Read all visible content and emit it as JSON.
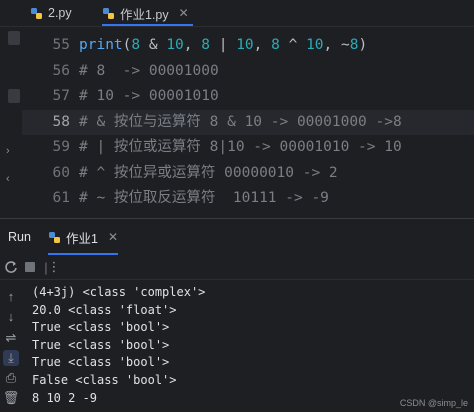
{
  "tabs": [
    {
      "label": "2.py",
      "active": false
    },
    {
      "label": "作业1.py",
      "active": true
    }
  ],
  "editor": {
    "lines": [
      {
        "num": "55",
        "current": false,
        "tokens": [
          {
            "t": "print",
            "c": "fn"
          },
          {
            "t": "(",
            "c": "txt"
          },
          {
            "t": "8",
            "c": "num"
          },
          {
            "t": " & ",
            "c": "txt"
          },
          {
            "t": "10",
            "c": "num"
          },
          {
            "t": ", ",
            "c": "txt"
          },
          {
            "t": "8",
            "c": "num"
          },
          {
            "t": " | ",
            "c": "txt"
          },
          {
            "t": "10",
            "c": "num"
          },
          {
            "t": ", ",
            "c": "txt"
          },
          {
            "t": "8",
            "c": "num"
          },
          {
            "t": " ^ ",
            "c": "txt"
          },
          {
            "t": "10",
            "c": "num"
          },
          {
            "t": ", ~",
            "c": "txt"
          },
          {
            "t": "8",
            "c": "num"
          },
          {
            "t": ")",
            "c": "txt"
          }
        ]
      },
      {
        "num": "56",
        "current": false,
        "tokens": [
          {
            "t": "# 8  -> 00001000",
            "c": "cmt"
          }
        ]
      },
      {
        "num": "57",
        "current": false,
        "tokens": [
          {
            "t": "# 10 -> 00001010",
            "c": "cmt"
          }
        ]
      },
      {
        "num": "58",
        "current": true,
        "tokens": [
          {
            "t": "# & 按位与运算符 8 & 10 -> 00001000 ->8",
            "c": "cmt"
          }
        ]
      },
      {
        "num": "59",
        "current": false,
        "tokens": [
          {
            "t": "# | 按位或运算符 8|10 -> 00001010 -> 10",
            "c": "cmt"
          }
        ]
      },
      {
        "num": "60",
        "current": false,
        "tokens": [
          {
            "t": "# ^ 按位异或运算符 00000010 -> 2",
            "c": "cmt"
          }
        ]
      },
      {
        "num": "61",
        "current": false,
        "tokens": [
          {
            "t": "# ~ 按位取反运算符  10111 -> -9",
            "c": "cmt"
          }
        ]
      }
    ]
  },
  "run_panel": {
    "label": "Run",
    "tab_label": "作业1",
    "output": [
      "(4+3j) <class 'complex'>",
      "20.0 <class 'float'>",
      "True <class 'bool'>",
      "True <class 'bool'>",
      "True <class 'bool'>",
      "False <class 'bool'>",
      "8 10 2 -9"
    ]
  },
  "watermark": "CSDN @simp_le",
  "colors": {
    "background": "#1e1f22",
    "accent": "#3574f0",
    "number": "#2aacb8",
    "function": "#56a8f5",
    "comment": "#7a7e85"
  }
}
